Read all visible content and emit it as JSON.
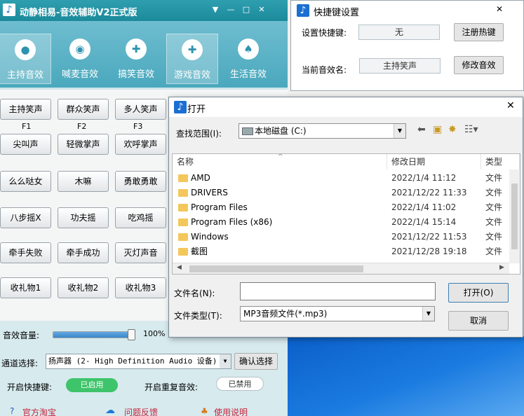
{
  "app": {
    "title": "动静相易-音效辅助V2正式版",
    "categories": [
      {
        "label": "主持音效",
        "icon": "person-icon"
      },
      {
        "label": "喊麦音效",
        "icon": "disc-icon"
      },
      {
        "label": "搞笑音效",
        "icon": "gamepad-icon"
      },
      {
        "label": "游戏音效",
        "icon": "gamepad-icon"
      },
      {
        "label": "生活音效",
        "icon": "bell-icon"
      }
    ],
    "sound_buttons": [
      [
        "主持笑声",
        "群众笑声",
        "多人笑声"
      ],
      [
        "尖叫声",
        "轻微掌声",
        "欢呼掌声"
      ],
      [
        "么么哒女",
        "木嘛",
        "勇敢勇敢"
      ],
      [
        "八步摇X",
        "功夫摇",
        "吃鸡摇"
      ],
      [
        "牵手失败",
        "牵手成功",
        "灭灯声音"
      ],
      [
        "收礼物1",
        "收礼物2",
        "收礼物3"
      ]
    ],
    "fkeys": [
      "F1",
      "F2",
      "F3"
    ],
    "volume": {
      "label": "音效音量:",
      "percent": "100%",
      "value": 1.0
    },
    "channel": {
      "label": "通道选择:",
      "value": "扬声器 (2- High Definition Audio 设备)",
      "confirm": "确认选择"
    },
    "hotkey_toggle": {
      "label": "开启快捷键:",
      "state": "已启用"
    },
    "repeat_toggle": {
      "label": "开启重复音效:",
      "state": "已禁用"
    },
    "links": [
      "官方淘宝",
      "问题反馈",
      "使用说明"
    ]
  },
  "hotkey_panel": {
    "title": "快捷键设置",
    "set_label": "设置快捷键:",
    "set_value": "无",
    "register_button": "注册热键",
    "current_label": "当前音效名:",
    "current_value": "主持笑声",
    "modify_button": "修改音效"
  },
  "open_dialog": {
    "title": "打开",
    "look_in_label": "查找范围(I):",
    "look_in_value": "本地磁盘 (C:)",
    "columns": {
      "name": "名称",
      "date": "修改日期",
      "type": "类型"
    },
    "files": [
      {
        "name": "AMD",
        "date": "2022/1/4 11:12",
        "type": "文件"
      },
      {
        "name": "DRIVERS",
        "date": "2021/12/22 11:33",
        "type": "文件"
      },
      {
        "name": "Program Files",
        "date": "2022/1/4 11:02",
        "type": "文件"
      },
      {
        "name": "Program Files (x86)",
        "date": "2022/1/4 15:14",
        "type": "文件"
      },
      {
        "name": "Windows",
        "date": "2021/12/22 11:53",
        "type": "文件"
      },
      {
        "name": "截图",
        "date": "2021/12/28 19:18",
        "type": "文件"
      }
    ],
    "filename_label": "文件名(N):",
    "filename_value": "",
    "filetype_label": "文件类型(T):",
    "filetype_value": "MP3音频文件(*.mp3)",
    "open_button": "打开(O)",
    "cancel_button": "取消"
  },
  "colors": {
    "accent": "#2f9fb0",
    "enabled": "#3ec46a"
  }
}
